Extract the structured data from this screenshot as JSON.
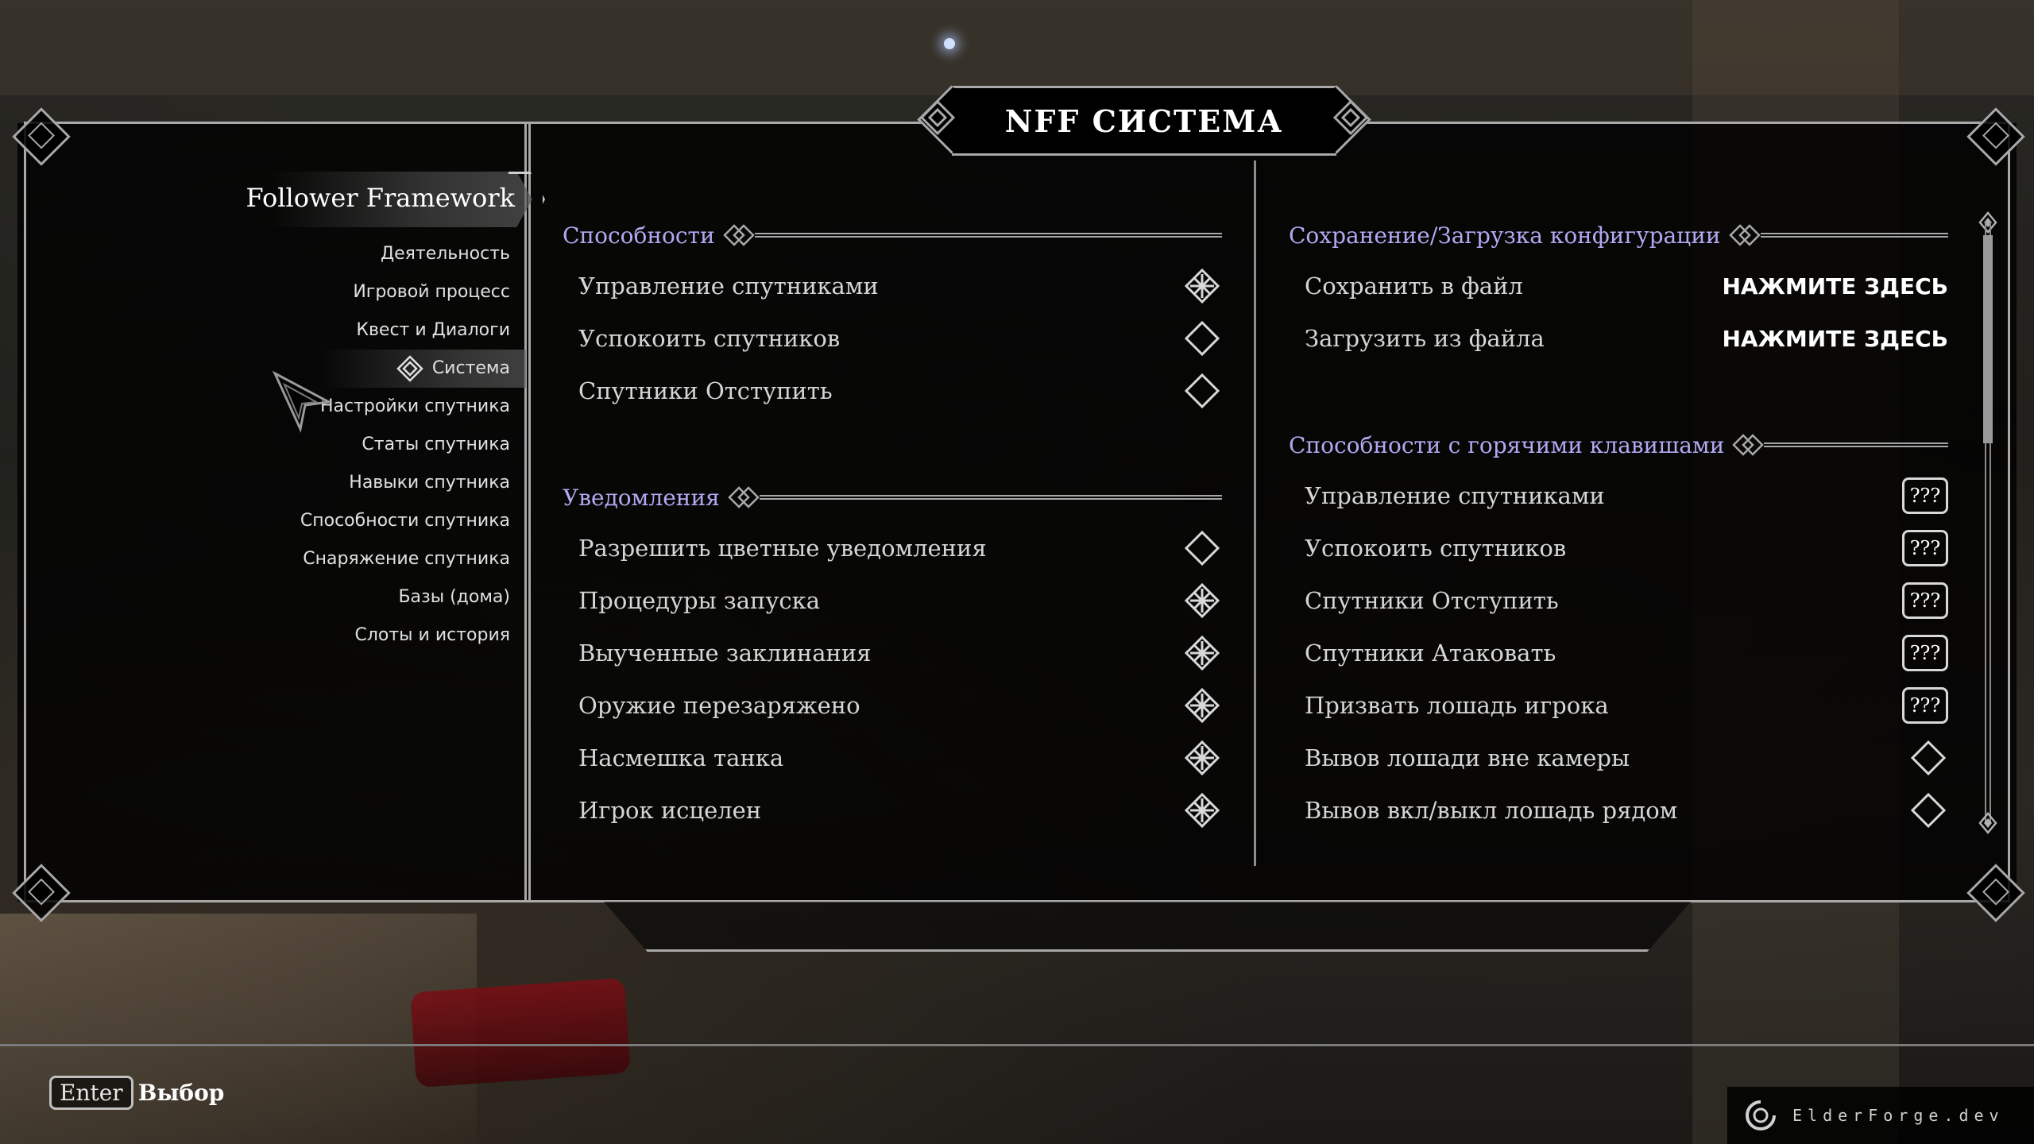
{
  "window": {
    "title": "NFF СИСТЕМА"
  },
  "sidebar": {
    "mod_title": "Follower Framework",
    "items": [
      {
        "label": "Деятельность",
        "selected": false
      },
      {
        "label": "Игровой процесс",
        "selected": false
      },
      {
        "label": "Квест и Диалоги",
        "selected": false
      },
      {
        "label": "Система",
        "selected": true
      },
      {
        "label": "Настройки спутника",
        "selected": false
      },
      {
        "label": "Статы спутника",
        "selected": false
      },
      {
        "label": "Навыки спутника",
        "selected": false
      },
      {
        "label": "Способности спутника",
        "selected": false
      },
      {
        "label": "Снаряжение спутника",
        "selected": false
      },
      {
        "label": "Базы (дома)",
        "selected": false
      },
      {
        "label": "Слоты и история",
        "selected": false
      }
    ]
  },
  "left_column": {
    "abilities": {
      "header": "Способности",
      "rows": [
        {
          "label": "Управление спутниками",
          "state": "on"
        },
        {
          "label": "Успокоить спутников",
          "state": "off"
        },
        {
          "label": "Спутники Отступить",
          "state": "off"
        }
      ]
    },
    "notifications": {
      "header": "Уведомления",
      "rows": [
        {
          "label": "Разрешить цветные уведомления",
          "state": "off"
        },
        {
          "label": "Процедуры запуска",
          "state": "on"
        },
        {
          "label": "Выученные заклинания",
          "state": "on"
        },
        {
          "label": "Оружие перезаряжено",
          "state": "on"
        },
        {
          "label": "Насмешка танка",
          "state": "on"
        },
        {
          "label": "Игрок исцелен",
          "state": "on"
        }
      ]
    }
  },
  "right_column": {
    "config": {
      "header": "Сохранение/Загрузка конфигурации",
      "rows": [
        {
          "label": "Сохранить в файл",
          "value": "НАЖМИТЕ ЗДЕСЬ"
        },
        {
          "label": "Загрузить из файла",
          "value": "НАЖМИТЕ ЗДЕСЬ"
        }
      ]
    },
    "hotkeys": {
      "header": "Способности с горячими клавишами",
      "rows": [
        {
          "label": "Управление спутниками",
          "key": "???"
        },
        {
          "label": "Успокоить спутников",
          "key": "???"
        },
        {
          "label": "Спутники Отступить",
          "key": "???"
        },
        {
          "label": "Спутники Атаковать",
          "key": "???"
        },
        {
          "label": "Призвать лошадь игрока",
          "key": "???"
        },
        {
          "label": "Вывов лошади вне камеры",
          "state": "off"
        },
        {
          "label": "Вывов вкл/выкл лошадь рядом",
          "state": "off"
        }
      ]
    }
  },
  "footer": {
    "key": "Enter",
    "action": "Выбор",
    "watermark": "ElderForge.dev"
  },
  "colors": {
    "section_header": "#b3a8f2",
    "frame": "#a8a8a8",
    "panel_bg": "#000000"
  }
}
